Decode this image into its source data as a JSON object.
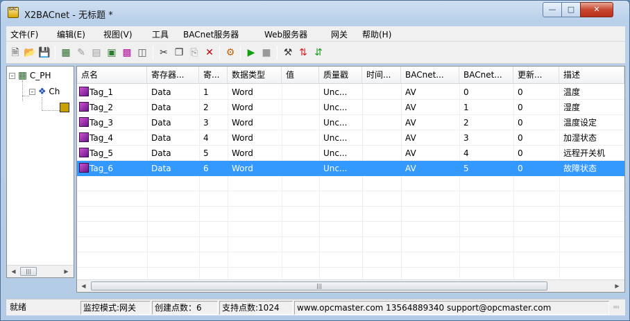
{
  "window": {
    "title": "X2BACnet - 无标题 *",
    "app_icon_text": "BAC"
  },
  "menu": [
    "文件(F)",
    "编辑(E)",
    "视图(V)",
    "工具",
    "BACnet服务器",
    "Web服务器",
    "网关",
    "帮助(H)"
  ],
  "toolbar": {
    "icons": [
      "new-icon",
      "open-icon",
      "save-icon",
      "device-icon",
      "add-tag-icon",
      "tag-list-icon",
      "export-icon",
      "import-icon",
      "properties-icon",
      "cut-icon",
      "copy-icon",
      "paste-icon",
      "delete-icon",
      "monitor-icon",
      "start-icon",
      "stop-icon",
      "tools-icon",
      "bacnet-icon",
      "gateway-icon"
    ]
  },
  "tree": {
    "root_label": "C_PH",
    "child_label": "Ch"
  },
  "columns": [
    "点名",
    "寄存器...",
    "寄...",
    "数据类型",
    "值",
    "质量戳",
    "时间...",
    "BACnet...",
    "BACnet...",
    "更新...",
    "描述"
  ],
  "rows": [
    [
      "Tag_1",
      "Data",
      "1",
      "Word",
      "",
      "Unc...",
      "",
      "AV",
      "0",
      "0",
      "温度"
    ],
    [
      "Tag_2",
      "Data",
      "2",
      "Word",
      "",
      "Unc...",
      "",
      "AV",
      "1",
      "0",
      "湿度"
    ],
    [
      "Tag_3",
      "Data",
      "3",
      "Word",
      "",
      "Unc...",
      "",
      "AV",
      "2",
      "0",
      "温度设定"
    ],
    [
      "Tag_4",
      "Data",
      "4",
      "Word",
      "",
      "Unc...",
      "",
      "AV",
      "3",
      "0",
      "加湿状态"
    ],
    [
      "Tag_5",
      "Data",
      "5",
      "Word",
      "",
      "Unc...",
      "",
      "AV",
      "4",
      "0",
      "远程开关机"
    ],
    [
      "Tag_6",
      "Data",
      "6",
      "Word",
      "",
      "Unc...",
      "",
      "AV",
      "5",
      "0",
      "故障状态"
    ]
  ],
  "selected_row": 5,
  "status": {
    "ready": "就绪",
    "mode": "监控模式:网关",
    "created": "创建点数：6",
    "supported": "支持点数:1024",
    "contact": "www.opcmaster.com 13564889340 support@opcmaster.com"
  },
  "colors": {
    "selection": "#3399ff",
    "tag_icon": "#a03ab0"
  }
}
